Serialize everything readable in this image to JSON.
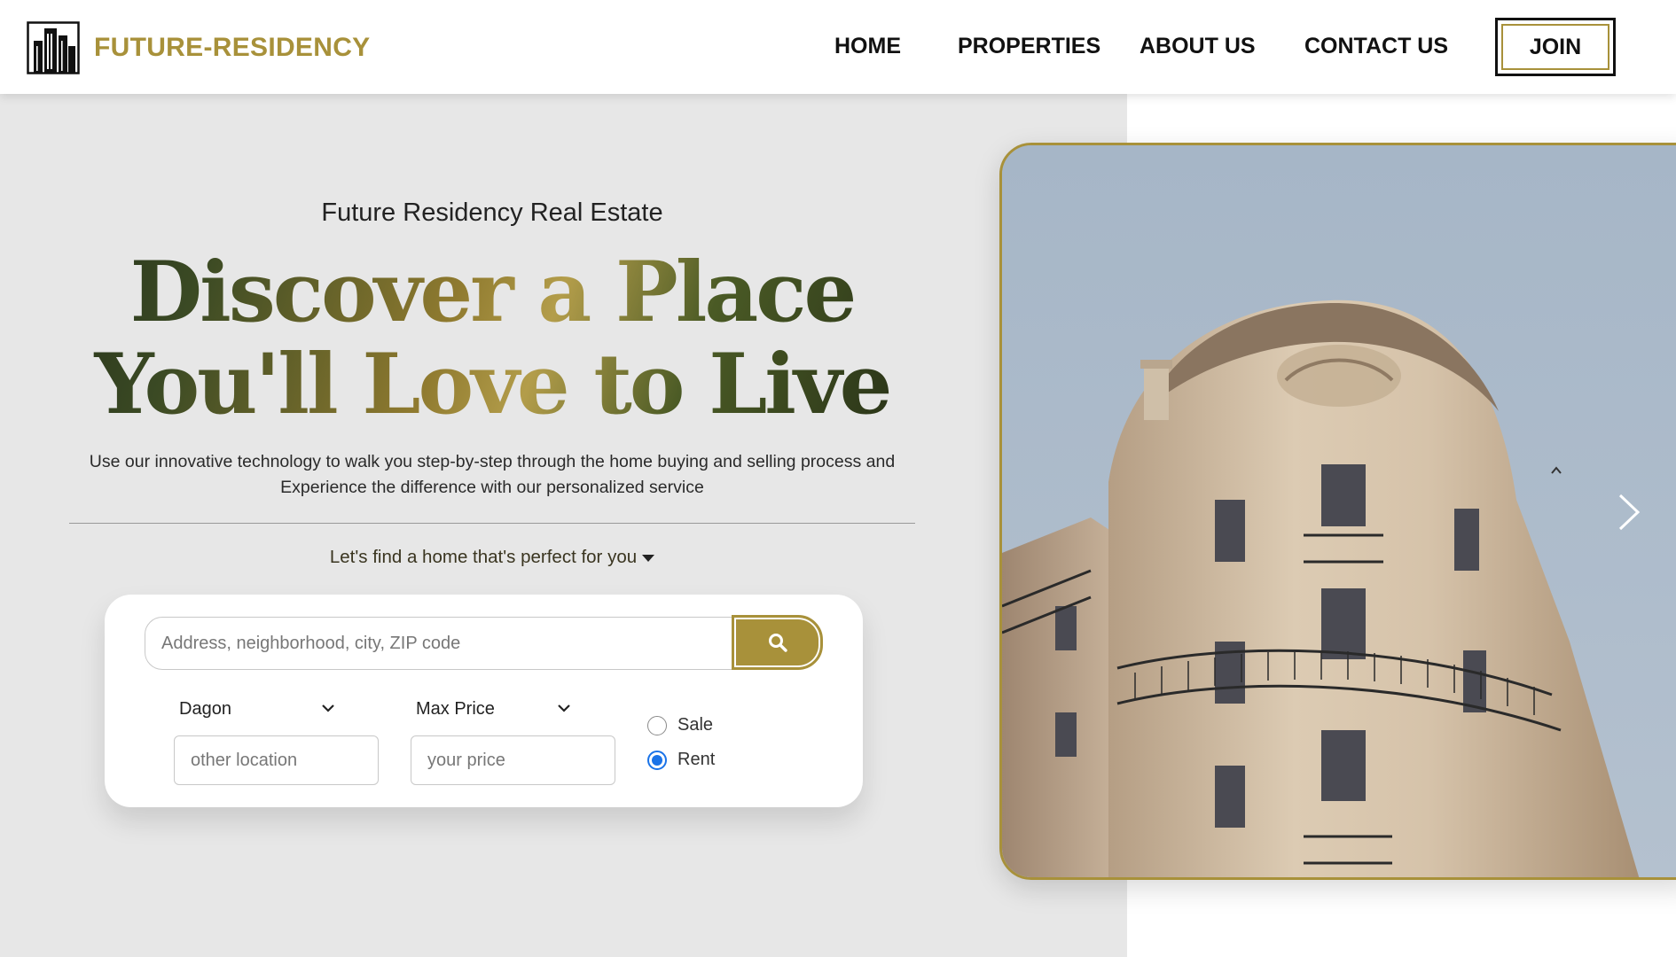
{
  "brand": {
    "name": "FUTURE-RESIDENCY",
    "accent_color": "#a8913a",
    "logo_icon": "buildings-icon"
  },
  "nav": {
    "items": [
      {
        "label": "HOME"
      },
      {
        "label": "PROPERTIES"
      },
      {
        "label": "ABOUT US"
      },
      {
        "label": "CONTACT US"
      }
    ],
    "join_label": "JOIN"
  },
  "hero": {
    "eyebrow": "Future Residency Real Estate",
    "headline_line1": "Discover a Place",
    "headline_line2": "You'll Love to Live",
    "subtext_line1": "Use our innovative technology to walk you step-by-step through the home buying and selling process and",
    "subtext_line2": "Experience the difference with our personalized service",
    "prompt": "Let's find a home that's perfect for you"
  },
  "search": {
    "placeholder": "Address, neighborhood, city, ZIP code",
    "button_icon": "search-icon",
    "location_select": {
      "selected": "Dagon"
    },
    "location_placeholder": "other location",
    "price_select": {
      "selected": "Max Price"
    },
    "price_placeholder": "your price",
    "listing_type": {
      "options": [
        "Sale",
        "Rent"
      ],
      "selected": "Rent"
    }
  },
  "carousel": {
    "image": "parisian-building-photo",
    "next_icon": "chevron-right-icon"
  }
}
